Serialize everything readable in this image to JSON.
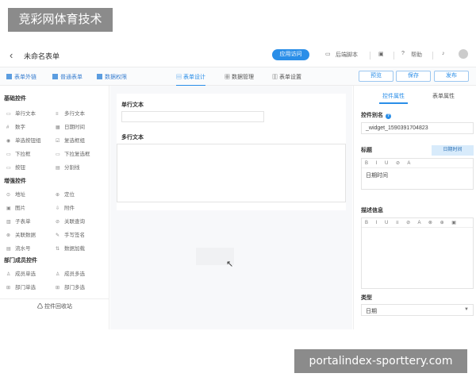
{
  "watermarks": {
    "top": "竞彩网体育技术",
    "bottom": "portalindex-sporttery.com"
  },
  "header": {
    "back_icon": "‹",
    "form_title": "未命名表单",
    "publish_button": "应用访问",
    "items": [
      "后端脚本",
      "帮助"
    ]
  },
  "toolbar": {
    "left": [
      "表单外链",
      "普通表单",
      "数据权限"
    ],
    "center": [
      "表单设计",
      "数据管理",
      "表单设置"
    ],
    "active_center": "表单设计",
    "buttons": [
      "预览",
      "保存",
      "发布"
    ]
  },
  "left_panel": {
    "sections": [
      {
        "title": "基础控件",
        "items": [
          "单行文本",
          "多行文本",
          "数字",
          "日期时间",
          "单选按钮组",
          "复选框组",
          "下拉框",
          "下拉复选框",
          "按钮",
          "分割线"
        ]
      },
      {
        "title": "增强控件",
        "items": [
          "地址",
          "定位",
          "图片",
          "附件",
          "子表单",
          "关联查询",
          "关联数据",
          "手写签名",
          "流水号",
          "数据加载"
        ]
      },
      {
        "title": "部门成员控件",
        "items": [
          "成员单选",
          "成员多选",
          "部门单选",
          "部门多选"
        ]
      }
    ],
    "recycle": "控件回收站"
  },
  "canvas": {
    "fields": [
      {
        "label": "单行文本"
      },
      {
        "label": "多行文本"
      }
    ]
  },
  "right_panel": {
    "tabs": [
      "控件属性",
      "表单属性"
    ],
    "active_tab": "控件属性",
    "alias_label": "控件别名",
    "alias_value": "_widget_1590391704823",
    "title_label": "标题",
    "title_chip": "日期时间",
    "title_value": "日期时间",
    "desc_label": "描述信息",
    "type_label": "类型",
    "type_value": "日期",
    "editor_tools_short": "B I U ⊘ A",
    "editor_tools_full": "B I U ≡ ⊘ A ⊗ ⊕ ▣"
  },
  "colors": {
    "accent": "#2a8ee8",
    "watermark_bg": "#8b8b8b"
  }
}
